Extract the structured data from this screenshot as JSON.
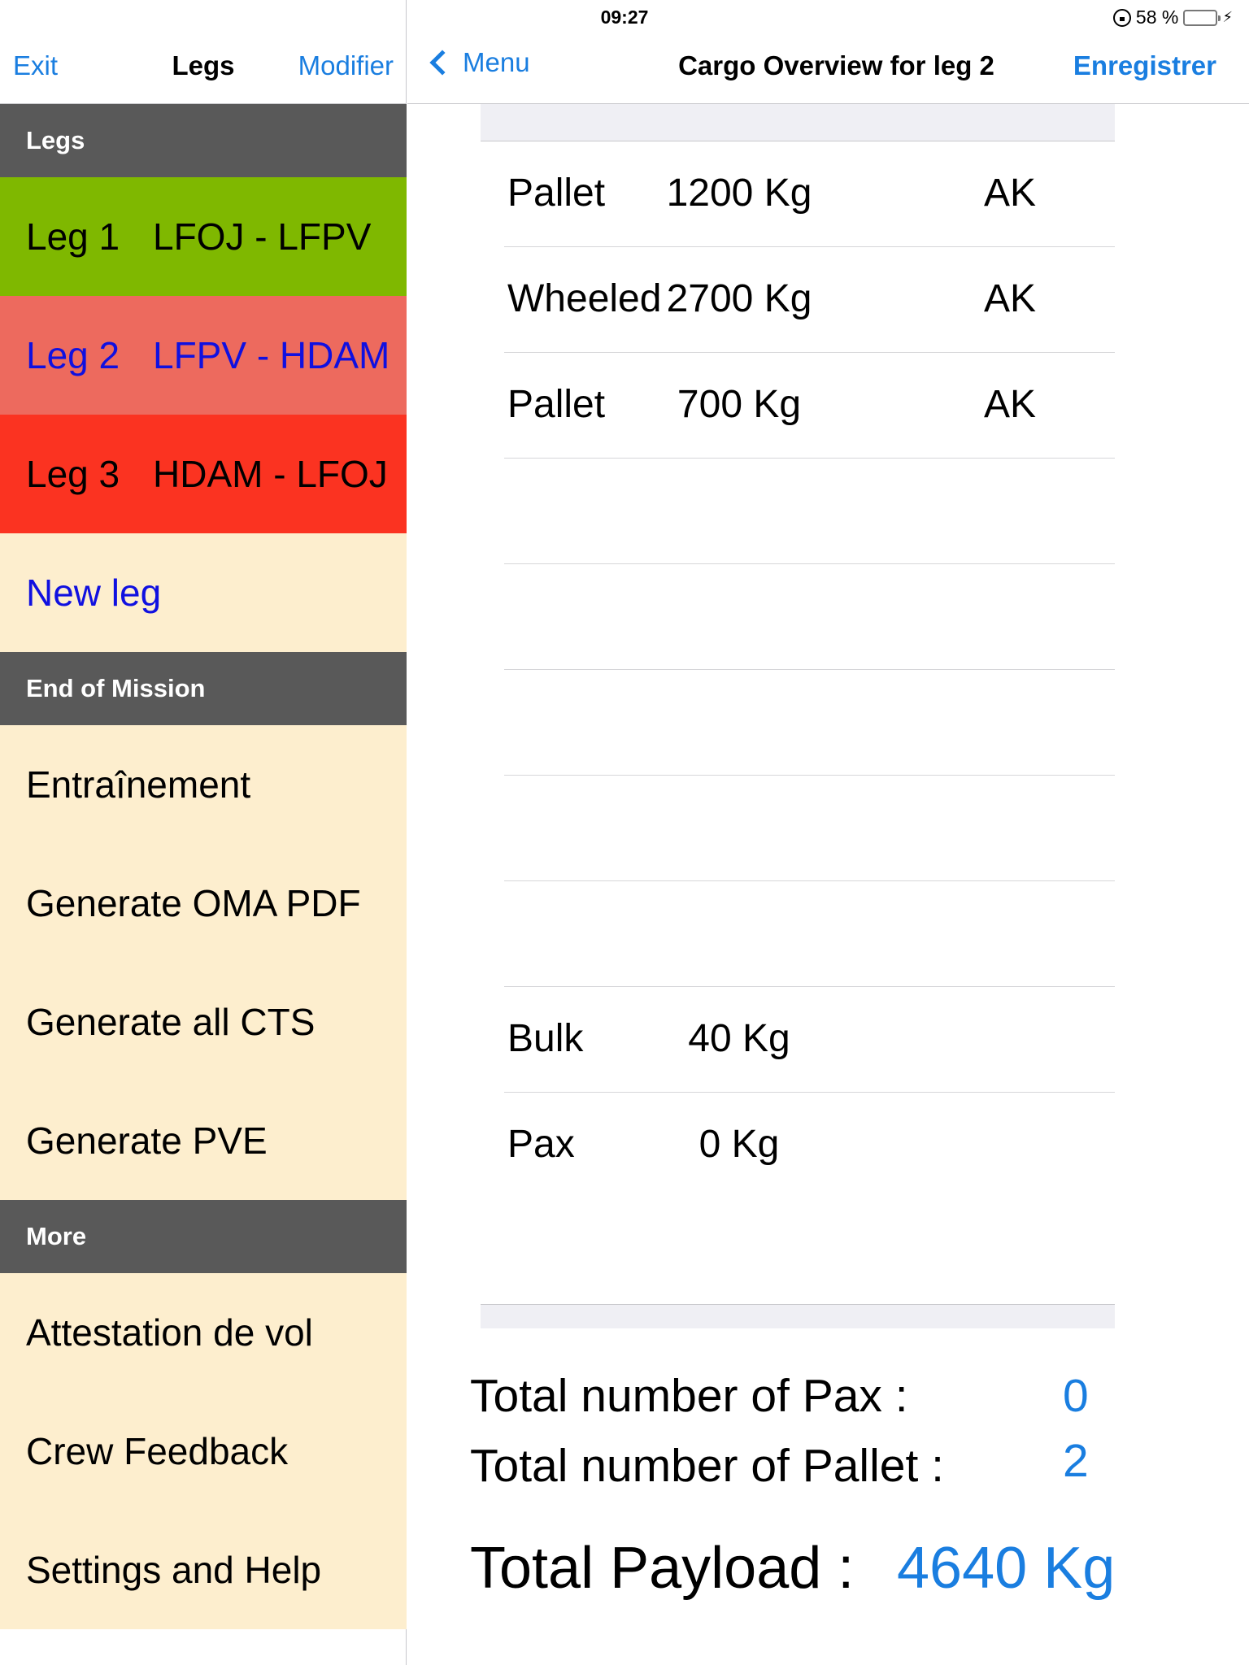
{
  "status_bar": {
    "device": "iPad",
    "time": "09:27",
    "battery": "58 %",
    "battery_level": 0.58
  },
  "left_nav": {
    "left_button": "Exit",
    "title": "Legs",
    "right_button": "Modifier"
  },
  "sections": {
    "legs_header": "Legs",
    "legs": [
      {
        "name": "Leg 1",
        "route": "LFOJ - LFPV",
        "color": "#7fb800"
      },
      {
        "name": "Leg 2",
        "route": "LFPV - HDAM",
        "color": "#ed6a5e"
      },
      {
        "name": "Leg 3",
        "route": "HDAM - LFOJ",
        "color": "#fb3321"
      }
    ],
    "new_leg": "New leg",
    "end_header": "End of Mission",
    "end_items": [
      "Entraînement",
      "Generate OMA PDF",
      "Generate all CTS",
      "Generate PVE"
    ],
    "more_header": "More",
    "more_items": [
      "Attestation de vol",
      "Crew Feedback",
      "Settings and Help"
    ]
  },
  "right_nav": {
    "back_button": "Menu",
    "title": "Cargo Overview for leg 2",
    "save_button": "Enregistrer"
  },
  "cargo": [
    {
      "type": "Pallet",
      "weight": "1200 Kg",
      "code": "AK"
    },
    {
      "type": "Wheeled",
      "weight": "2700 Kg",
      "code": "AK"
    },
    {
      "type": "Pallet",
      "weight": "700 Kg",
      "code": "AK"
    },
    {
      "type": "",
      "weight": "",
      "code": ""
    },
    {
      "type": "",
      "weight": "",
      "code": ""
    },
    {
      "type": "",
      "weight": "",
      "code": ""
    },
    {
      "type": "",
      "weight": "",
      "code": ""
    },
    {
      "type": "",
      "weight": "",
      "code": ""
    },
    {
      "type": "Bulk",
      "weight": "40 Kg",
      "code": ""
    },
    {
      "type": "Pax",
      "weight": "0 Kg",
      "code": ""
    }
  ],
  "totals": {
    "pax_label": "Total number of Pax :",
    "pax_value": "0",
    "pallet_label": "Total number of Pallet :",
    "pallet_value": "2",
    "payload_label": "Total Payload :",
    "payload_value": "4640 Kg"
  },
  "colors": {
    "accent_blue": "#1a7ee0",
    "section_header": "#595959",
    "cell_background": "#fdeece"
  }
}
